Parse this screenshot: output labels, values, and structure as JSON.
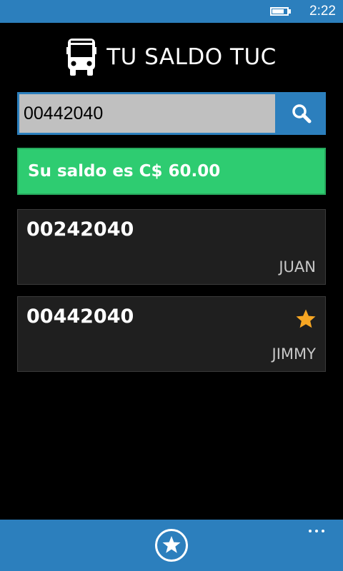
{
  "status_bar": {
    "time": "2:22",
    "battery_level": 0.8
  },
  "header": {
    "title": "TU SALDO TUC",
    "icon": "bus-icon"
  },
  "search": {
    "value": "00442040",
    "button_icon": "search-icon"
  },
  "balance": {
    "text": "Su saldo es C$ 60.00"
  },
  "cards": [
    {
      "number": "00242040",
      "name": "JUAN",
      "favorite": false
    },
    {
      "number": "00442040",
      "name": "JIMMY",
      "favorite": true
    }
  ],
  "app_bar": {
    "primary_icon": "star-circle-icon",
    "more_icon": "more-dots-icon"
  },
  "colors": {
    "accent": "#2c7fbd",
    "success": "#2ecc71",
    "star": "#f6a623",
    "card_bg": "#1f1f1f"
  }
}
